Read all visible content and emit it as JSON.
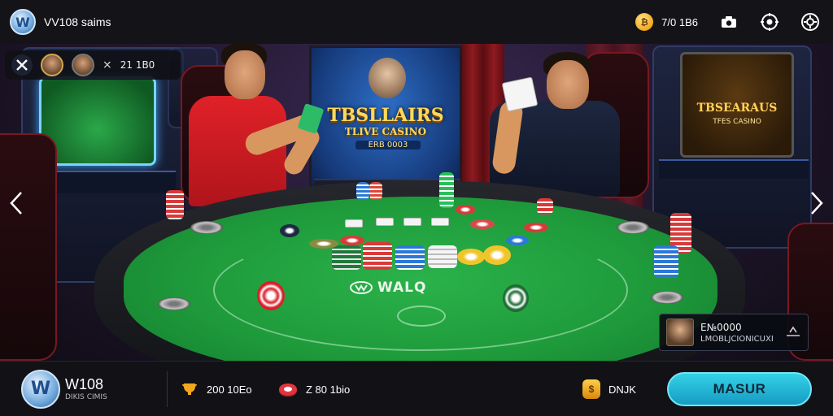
{
  "header": {
    "title": "VV108 saims",
    "balance": "7/0 1B6",
    "icons": [
      "coin-icon",
      "camera-icon",
      "settings-icon",
      "gear-icon"
    ]
  },
  "players_bar": {
    "text": "21 1B0",
    "icons": [
      "tools-icon",
      "player-avatar",
      "player-avatar",
      "close-icon"
    ]
  },
  "stage": {
    "title_line1": "TBSLLAIRS",
    "title_line2": "TLIVE CASINO",
    "subtitle": "ERB 0003"
  },
  "side_screen": {
    "title_line1": "TBSEARAUS",
    "title_line2": "TFES CASINO"
  },
  "table": {
    "logo_text": "WALQ"
  },
  "player_card": {
    "amount": "E№0000",
    "name": "LMOBLJCIONICUXI"
  },
  "footer": {
    "id_main": "W108",
    "id_sub": "DIKIS CIMIS",
    "stat1": "200 10Eo",
    "stat2": "Z 80 1bio",
    "stat3": "DNJK",
    "button": "MASUR"
  },
  "colors": {
    "felt": "#1e9a3b",
    "accent_button": "#35d1e8",
    "gold": "#f2a81d"
  }
}
